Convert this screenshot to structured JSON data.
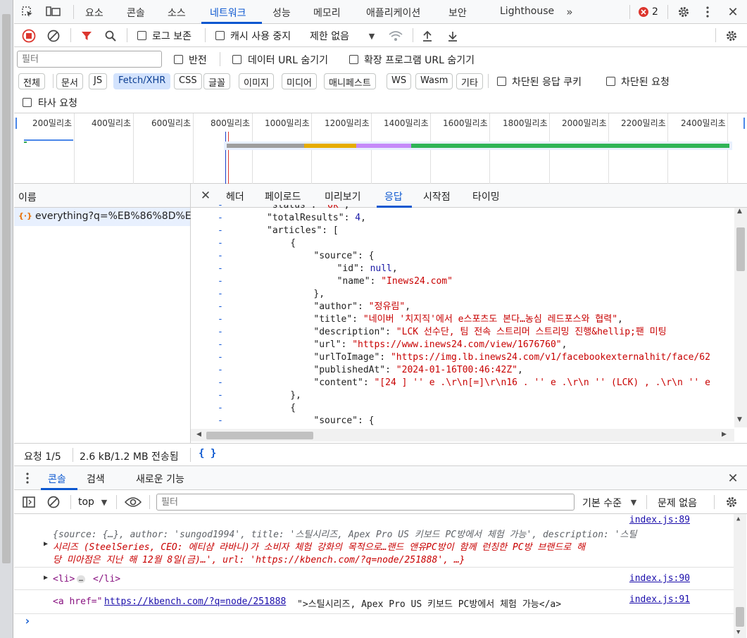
{
  "tabs": [
    "요소",
    "콘솔",
    "소스",
    "네트워크",
    "성능",
    "메모리",
    "애플리케이션",
    "보안",
    "Lighthouse"
  ],
  "issues_count": "2",
  "toolbar": {
    "preserve_log": "로그 보존",
    "disable_cache": "캐시 사용 중지",
    "throttle": "제한 없음"
  },
  "filter": {
    "placeholder": "필터",
    "invert": "반전",
    "hide_data_urls": "데이터 URL 숨기기",
    "hide_ext_urls": "확장 프로그램 URL 숨기기"
  },
  "type_chips": [
    "전체",
    "문서",
    "JS",
    "Fetch/XHR",
    "CSS",
    "글꼴",
    "이미지",
    "미디어",
    "매니페스트",
    "WS",
    "Wasm",
    "기타"
  ],
  "blocked_cookies": "차단된 응답 쿠키",
  "blocked_requests": "차단된 요청",
  "third_party": "타사 요청",
  "timeline_ticks": [
    "200밀리초",
    "400밀리초",
    "600밀리초",
    "800밀리초",
    "1000밀리초",
    "1200밀리초",
    "1400밀리초",
    "1600밀리초",
    "1800밀리초",
    "2000밀리초",
    "2200밀리초",
    "2400밀리초"
  ],
  "name_header": "이름",
  "request_name": "everything?q=%EB%86%8D%E...",
  "detail_tabs": [
    "헤더",
    "페이로드",
    "미리보기",
    "응답",
    "시작점",
    "타이밍"
  ],
  "response_lines": [
    {
      "indent": 6,
      "parts": [
        [
          "k",
          "\"status\": "
        ],
        [
          "s",
          "\"ok\""
        ],
        [
          "k",
          ","
        ]
      ]
    },
    {
      "indent": 6,
      "parts": [
        [
          "k",
          "\"totalResults\": "
        ],
        [
          "n",
          "4"
        ],
        [
          "k",
          ","
        ]
      ]
    },
    {
      "indent": 6,
      "parts": [
        [
          "k",
          "\"articles\": ["
        ]
      ]
    },
    {
      "indent": 10,
      "parts": [
        [
          "k",
          "{"
        ]
      ]
    },
    {
      "indent": 14,
      "parts": [
        [
          "k",
          "\"source\": {"
        ]
      ]
    },
    {
      "indent": 18,
      "parts": [
        [
          "k",
          "\"id\": "
        ],
        [
          "n",
          "null"
        ],
        [
          "k",
          ","
        ]
      ]
    },
    {
      "indent": 18,
      "parts": [
        [
          "k",
          "\"name\": "
        ],
        [
          "s",
          "\"Inews24.com\""
        ]
      ]
    },
    {
      "indent": 14,
      "parts": [
        [
          "k",
          "},"
        ]
      ]
    },
    {
      "indent": 14,
      "parts": [
        [
          "k",
          "\"author\": "
        ],
        [
          "s",
          "\"정유림\""
        ],
        [
          "k",
          ","
        ]
      ]
    },
    {
      "indent": 14,
      "parts": [
        [
          "k",
          "\"title\": "
        ],
        [
          "s",
          "\"네이버 '치지직'에서 e스포츠도 본다…농심 레드포스와 협력\""
        ],
        [
          "k",
          ","
        ]
      ]
    },
    {
      "indent": 14,
      "parts": [
        [
          "k",
          "\"description\": "
        ],
        [
          "s",
          "\"LCK 선수단, 팀 전속 스트리머 스트리밍 진행&hellip;팬 미팅"
        ]
      ]
    },
    {
      "indent": 14,
      "parts": [
        [
          "k",
          "\"url\": "
        ],
        [
          "s",
          "\"https://www.inews24.com/view/1676760\""
        ],
        [
          "k",
          ","
        ]
      ]
    },
    {
      "indent": 14,
      "parts": [
        [
          "k",
          "\"urlToImage\": "
        ],
        [
          "s",
          "\"https://img.lb.inews24.com/v1/facebookexternalhit/face/62"
        ]
      ]
    },
    {
      "indent": 14,
      "parts": [
        [
          "k",
          "\"publishedAt\": "
        ],
        [
          "s",
          "\"2024-01-16T00:46:42Z\""
        ],
        [
          "k",
          ","
        ]
      ]
    },
    {
      "indent": 14,
      "parts": [
        [
          "k",
          "\"content\": "
        ],
        [
          "s",
          "\"[24 ] '' e .\\r\\n[=]\\r\\n16 . '' e .\\r\\n '' (LCK) , .\\r\\n '' e"
        ]
      ]
    },
    {
      "indent": 10,
      "parts": [
        [
          "k",
          "},"
        ]
      ]
    },
    {
      "indent": 10,
      "parts": [
        [
          "k",
          "{"
        ]
      ]
    },
    {
      "indent": 14,
      "parts": [
        [
          "k",
          "\"source\": {"
        ]
      ]
    }
  ],
  "status": {
    "requests": "요청 1/5",
    "transferred": "2.6 kB/1.2 MB 전송됨",
    "pretty": "{ }"
  },
  "drawer_tabs": [
    "콘솔",
    "검색",
    "새로운 기능"
  ],
  "console_toolbar": {
    "context": "top",
    "filter_placeholder": "필터",
    "level": "기본 수준",
    "issues": "문제 없음"
  },
  "console": {
    "obj_line1": "{source: {…}, author: 'sungod1994', title: '스틸시리즈, Apex Pro US 키보드 PC방에서 체험 가능', description: '스틸",
    "obj_line2": "시리즈 (SteelSeries, CEO: 에티샴 라바니)가 소비자 체험 강화의 목적으로…랜드 앤유PC방이 함께 런칭한 PC방 브랜드로 해",
    "obj_line3": "당 미아점은 지난 해 12월 8일(금)…', url: 'https://kbench.com/?q=node/251888', …}",
    "src1": "index.js:89",
    "li_open": "<li>",
    "li_dots": "…",
    "li_close": "</li>",
    "src2": "index.js:90",
    "a_open": "<a href=\"",
    "a_href": "https://kbench.com/?q=node/251888",
    "a_mid": "\">스틸시리즈, Apex Pro US 키보드 PC방에서 체험 가능</a>",
    "src3": "index.js:91",
    "prompt": "›"
  },
  "colors": {
    "accent": "#0b57d0",
    "error": "#dc362e",
    "string": "#c80000"
  }
}
